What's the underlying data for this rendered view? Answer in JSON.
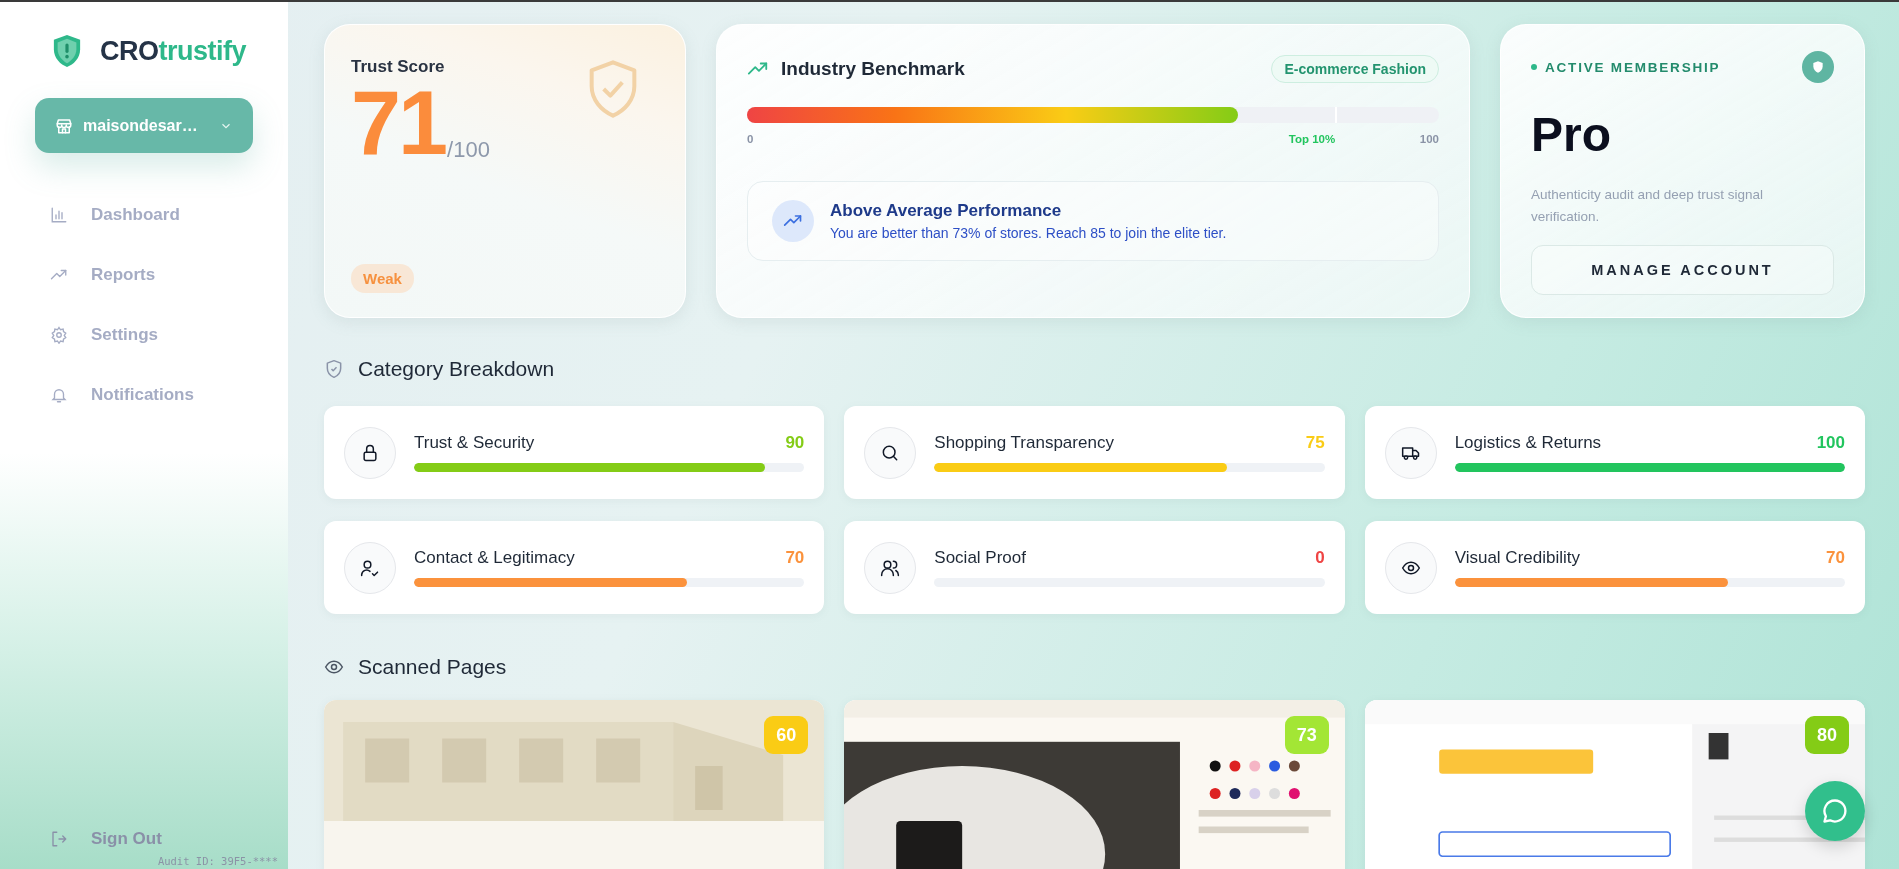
{
  "sidebar": {
    "brand_prefix": "CRO",
    "brand_suffix": "trustify",
    "store_selector": "maisondesar…",
    "nav": [
      {
        "label": "Dashboard"
      },
      {
        "label": "Reports"
      },
      {
        "label": "Settings"
      },
      {
        "label": "Notifications"
      }
    ],
    "sign_out": "Sign Out",
    "audit_id": "Audit ID: 39F5-****"
  },
  "trust_score": {
    "title": "Trust Score",
    "score": "71",
    "max": "/100",
    "rating": "Weak"
  },
  "benchmark": {
    "title": "Industry Benchmark",
    "segment": "E-commerce Fashion",
    "level": 0.71,
    "marker": {
      "level": 0.85
    },
    "scale_start": "0",
    "marker_label": "Top 10%",
    "scale_end": "100",
    "insight": {
      "title": "Above Average Performance",
      "text": "You are better than 73% of stores. Reach 85 to join the elite tier."
    }
  },
  "membership": {
    "label": "ACTIVE MEMBERSHIP",
    "plan": "Pro",
    "description": "Authenticity audit and deep trust signal verification.",
    "button": "MANAGE ACCOUNT"
  },
  "category_breakdown": {
    "title": "Category Breakdown",
    "items": [
      {
        "name": "Trust & Security",
        "score": "90",
        "level": 0.9,
        "color": "#84cc16"
      },
      {
        "name": "Shopping Transparency",
        "score": "75",
        "level": 0.75,
        "color": "#facc15"
      },
      {
        "name": "Logistics & Returns",
        "score": "100",
        "level": 1,
        "color": "#22c55e"
      },
      {
        "name": "Contact & Legitimacy",
        "score": "70",
        "level": 0.7,
        "color": "#fb923c"
      },
      {
        "name": "Social Proof",
        "score": "0",
        "level": 0,
        "color": "#ef4444"
      },
      {
        "name": "Visual Credibility",
        "score": "70",
        "level": 0.7,
        "color": "#fb923c"
      }
    ]
  },
  "scanned_pages": {
    "title": "Scanned Pages",
    "pages": [
      {
        "kind": "picture",
        "score": "60",
        "color": "#facc15"
      },
      {
        "kind": "picture",
        "score": "73",
        "color": "#a3e635"
      },
      {
        "kind": "picture",
        "score": "80",
        "color": "#84cc16"
      }
    ]
  }
}
